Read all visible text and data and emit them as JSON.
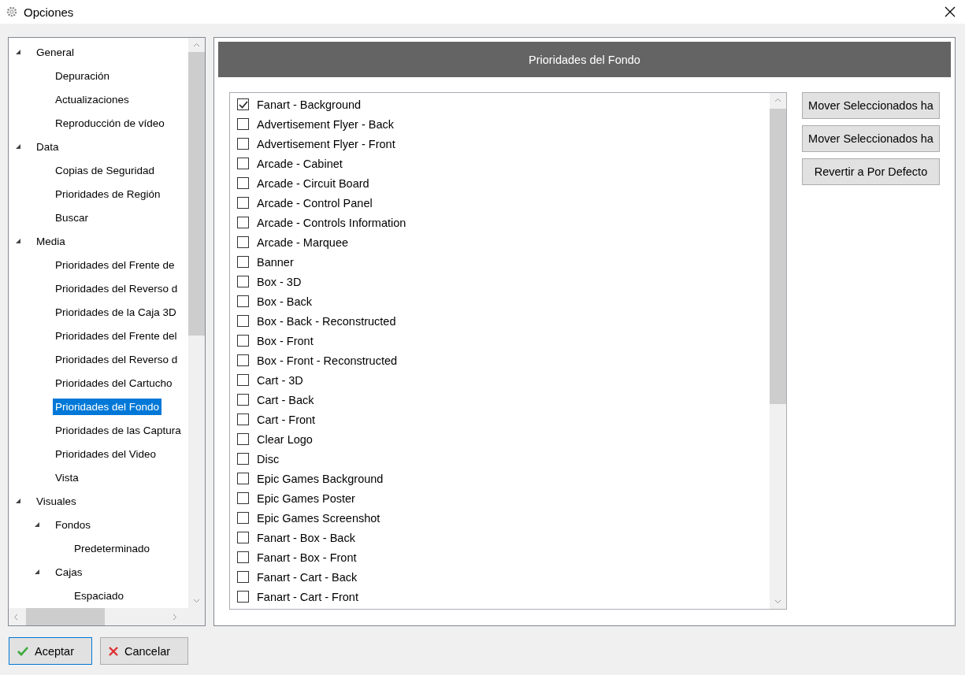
{
  "window": {
    "title": "Opciones"
  },
  "tree": [
    {
      "label": "General",
      "expanded": true,
      "selected": false,
      "children": [
        {
          "label": "Depuración",
          "selected": false
        },
        {
          "label": "Actualizaciones",
          "selected": false
        },
        {
          "label": "Reproducción de vídeo",
          "selected": false
        }
      ]
    },
    {
      "label": "Data",
      "expanded": true,
      "selected": false,
      "children": [
        {
          "label": "Copias de Seguridad",
          "selected": false
        },
        {
          "label": "Prioridades de Región",
          "selected": false
        },
        {
          "label": "Buscar",
          "selected": false
        }
      ]
    },
    {
      "label": "Media",
      "expanded": true,
      "selected": false,
      "children": [
        {
          "label": "Prioridades del Frente de",
          "selected": false
        },
        {
          "label": "Prioridades del Reverso d",
          "selected": false
        },
        {
          "label": "Prioridades de la Caja 3D",
          "selected": false
        },
        {
          "label": "Prioridades del Frente del",
          "selected": false
        },
        {
          "label": "Prioridades del Reverso d",
          "selected": false
        },
        {
          "label": "Prioridades del Cartucho",
          "selected": false
        },
        {
          "label": "Prioridades del Fondo",
          "selected": true
        },
        {
          "label": "Prioridades de las Captura",
          "selected": false
        },
        {
          "label": "Prioridades del Video",
          "selected": false
        },
        {
          "label": "Vista",
          "selected": false
        }
      ]
    },
    {
      "label": "Visuales",
      "expanded": true,
      "selected": false,
      "children": [
        {
          "label": "Fondos",
          "expanded": true,
          "selected": false,
          "children": [
            {
              "label": "Predeterminado",
              "selected": false
            }
          ]
        },
        {
          "label": "Cajas",
          "expanded": true,
          "selected": false,
          "children": [
            {
              "label": "Espaciado",
              "selected": false
            }
          ]
        }
      ]
    }
  ],
  "panel": {
    "title": "Prioridades del Fondo",
    "items": [
      {
        "label": "Fanart - Background",
        "checked": true
      },
      {
        "label": "Advertisement Flyer - Back",
        "checked": false
      },
      {
        "label": "Advertisement Flyer - Front",
        "checked": false
      },
      {
        "label": "Arcade - Cabinet",
        "checked": false
      },
      {
        "label": "Arcade - Circuit Board",
        "checked": false
      },
      {
        "label": "Arcade - Control Panel",
        "checked": false
      },
      {
        "label": "Arcade - Controls Information",
        "checked": false
      },
      {
        "label": "Arcade - Marquee",
        "checked": false
      },
      {
        "label": "Banner",
        "checked": false
      },
      {
        "label": "Box - 3D",
        "checked": false
      },
      {
        "label": "Box - Back",
        "checked": false
      },
      {
        "label": "Box - Back - Reconstructed",
        "checked": false
      },
      {
        "label": "Box - Front",
        "checked": false
      },
      {
        "label": "Box - Front - Reconstructed",
        "checked": false
      },
      {
        "label": "Cart - 3D",
        "checked": false
      },
      {
        "label": "Cart - Back",
        "checked": false
      },
      {
        "label": "Cart - Front",
        "checked": false
      },
      {
        "label": "Clear Logo",
        "checked": false
      },
      {
        "label": "Disc",
        "checked": false
      },
      {
        "label": "Epic Games Background",
        "checked": false
      },
      {
        "label": "Epic Games Poster",
        "checked": false
      },
      {
        "label": "Epic Games Screenshot",
        "checked": false
      },
      {
        "label": "Fanart - Box - Back",
        "checked": false
      },
      {
        "label": "Fanart - Box - Front",
        "checked": false
      },
      {
        "label": "Fanart - Cart - Back",
        "checked": false
      },
      {
        "label": "Fanart - Cart - Front",
        "checked": false
      }
    ],
    "buttons": [
      "Mover Seleccionados ha",
      "Mover Seleccionados ha",
      "Revertir a Por Defecto"
    ]
  },
  "footer_buttons": [
    {
      "label": "Aceptar",
      "kind": "ok"
    },
    {
      "label": "Cancelar",
      "kind": "cancel"
    }
  ]
}
